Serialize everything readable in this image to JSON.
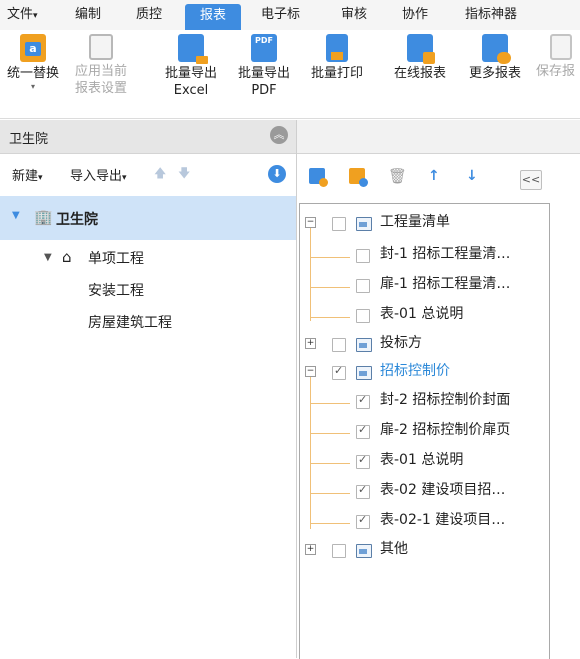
{
  "menu": {
    "items": [
      "文件",
      "编制",
      "质控",
      "报表",
      "电子标",
      "审核",
      "协作",
      "指标神器"
    ],
    "active": "报表"
  },
  "ribbon": {
    "buttons": [
      {
        "label1": "统一替换",
        "label2": "",
        "icon": "replace-icon",
        "disabled": false
      },
      {
        "label1": "应用当前",
        "label2": "报表设置",
        "icon": "apply-settings-icon",
        "disabled": true
      },
      {
        "label1": "批量导出",
        "label2": "Excel",
        "icon": "excel-export-icon",
        "disabled": false
      },
      {
        "label1": "批量导出",
        "label2": "PDF",
        "icon": "pdf-export-icon",
        "disabled": false
      },
      {
        "label1": "批量打印",
        "label2": "",
        "icon": "print-icon",
        "disabled": false
      },
      {
        "label1": "在线报表",
        "label2": "",
        "icon": "online-report-icon",
        "disabled": false
      },
      {
        "label1": "更多报表",
        "label2": "",
        "icon": "more-reports-icon",
        "disabled": false
      },
      {
        "label1": "保存报",
        "label2": "",
        "icon": "save-report-icon",
        "disabled": true
      }
    ],
    "pdf_icon_text": "PDF"
  },
  "left_panel": {
    "title": "卫生院",
    "toolbar": {
      "new_label": "新建",
      "import_export_label": "导入导出"
    },
    "tree": {
      "root": "卫生院",
      "child": "单项工程",
      "leaves": [
        "安装工程",
        "房屋建筑工程"
      ]
    }
  },
  "right_panel": {
    "collapse_label": "<<",
    "tree": [
      {
        "label": "工程量清单",
        "expanded": true,
        "checked": false,
        "children": [
          {
            "label": "封-1 招标工程量清…",
            "checked": false
          },
          {
            "label": "扉-1 招标工程量清…",
            "checked": false
          },
          {
            "label": "表-01 总说明",
            "checked": false
          }
        ]
      },
      {
        "label": "投标方",
        "expanded": false,
        "checked": false,
        "children": []
      },
      {
        "label": "招标控制价",
        "expanded": true,
        "checked": true,
        "selected": true,
        "children": [
          {
            "label": "封-2 招标控制价封面",
            "checked": true
          },
          {
            "label": "扉-2 招标控制价扉页",
            "checked": true
          },
          {
            "label": "表-01 总说明",
            "checked": true
          },
          {
            "label": "表-02 建设项目招…",
            "checked": true
          },
          {
            "label": "表-02-1 建设项目…",
            "checked": true
          }
        ]
      },
      {
        "label": "其他",
        "expanded": false,
        "checked": false,
        "children": []
      }
    ]
  },
  "colors": {
    "accent": "#3e8ce0",
    "selected_row": "#cfe3f8",
    "selected_text": "#2b88d8",
    "guide": "#f0c078"
  }
}
